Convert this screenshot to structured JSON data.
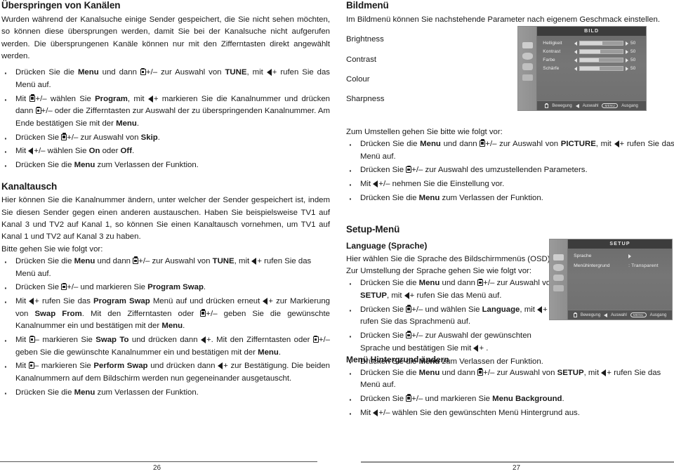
{
  "left_page": {
    "number": "26",
    "heading": "Überspringen von Kanälen",
    "intro": "Wurden während der Kanalsuche einige Sender gespeichert, die Sie nicht sehen möchten, so können diese übersprungen werden, damit Sie bei der Kanalsuche nicht aufgerufen werden. Die übersprungenen Kanäle können nur mit den Zifferntasten direkt angewählt werden.",
    "bullets": [
      "Drücken Sie die Menu und dann [CH]+/– zur Auswahl von TUNE, mit [VOL]+ rufen Sie das Menü auf.",
      "Mit [CH]+/– wählen Sie Program, mit [VOL]+ markieren Sie die Kanalnummer und drücken dann [CH]+/– oder die Zifferntasten zur Auswahl der zu überspringenden Kanalnummer. Am Ende bestätigen Sie mit der Menu.",
      "Drücken Sie [CH]+/– zur Auswahl von Skip.",
      "Mit [VOL]+/– wählen Sie On oder Off.",
      "Drücken Sie die Menu zum Verlassen der Funktion."
    ],
    "section2_heading": "Kanaltausch",
    "section2_intro": "Hier können Sie die Kanalnummer ändern, unter welcher der Sender gespeichert ist, indem Sie diesen Sender gegen einen anderen austauschen. Haben Sie beispielsweise TV1 auf Kanal 3 und TV2 auf Kanal 1, so können Sie einen Kanaltausch vornehmen, um TV1 auf Kanal 1 und TV2 auf Kanal 3 zu haben.",
    "section2_lead": "Bitte gehen Sie wie folgt vor:",
    "section2_bullets": [
      "Drücken Sie die Menu und dann [CH]+/– zur Auswahl von TUNE, mit [VOL]+ rufen Sie das Menü auf.",
      "Drücken Sie [CH]+/– und markieren Sie Program Swap.",
      "Mit [VOL]+ rufen Sie das Program Swap Menü auf und drücken erneut [VOL]+ zur Markierung von Swap From. Mit den Zifferntasten oder [CH]+/– geben Sie die gewünschte Kanalnummer ein und bestätigen mit der Menu.",
      "Mit [CH]– markieren Sie Swap To und drücken dann [VOL]+. Mit den Zifferntasten oder [CH]+/– geben Sie die gewünschte Kanalnummer ein und bestätigen mit der Menu.",
      "Mit [CH]– markieren Sie Perform Swap und drücken dann [VOL]+ zur Bestätigung. Die beiden Kanalnummern auf dem Bildschirm werden nun gegeneinander ausgetauscht.",
      "Drücken Sie die Menu zum Verlassen der Funktion."
    ]
  },
  "right_page": {
    "number": "27",
    "heading": "Bildmenü",
    "intro": "Im Bildmenü können Sie nachstehende Parameter nach eigenem Geschmack einstellen.",
    "params": [
      "Brightness",
      "Contrast",
      "Colour",
      "Sharpness"
    ],
    "change_lead": "Zum Umstellen gehen Sie bitte wie folgt vor:",
    "change_bullets": [
      "Drücken Sie die Menu und dann [CH]+/– zur Auswahl von PICTURE, mit [VOL]+ rufen Sie das Menü auf.",
      "Drücken Sie [CH]+/– zur Auswahl des umzustellenden Parameters.",
      "Mit [VOL]+/– nehmen Sie die Einstellung vor.",
      "Drücken Sie die Menu zum Verlassen der Funktion."
    ],
    "setup_heading": "Setup-Menü",
    "language_heading": "Language (Sprache)",
    "language_line1": "Hier wählen Sie die Sprache des Bildschirmmenüs (OSD).",
    "language_line2": "Zur Umstellung der Sprache gehen Sie wie folgt vor:",
    "language_bullets": [
      "Drücken Sie die Menu und dann [CH]+/– zur Auswahl von SETUP, mit [VOL]+ rufen Sie das Menü auf.",
      "Drücken Sie [CH]+/– und wählen Sie Language, mit [VOL]+ rufen Sie das Sprachmenü auf.",
      "Drücken Sie [CH]+/– zur Auswahl der gewünschten Sprache und bestätigen Sie mit [VOL]+ .",
      "Drücken Sie die Menu zum Verlassen der Funktion."
    ],
    "bg_heading": "Menü Hintergrund ändern",
    "bg_bullets": [
      "Drücken Sie die Menu und dann [CH]+/– zur Auswahl von SETUP, mit [VOL]+ rufen Sie das Menü auf.",
      "Drücken Sie [CH]+/– und markieren Sie Menu Background.",
      "Mit [VOL]+/– wählen Sie den gewünschten Menü Hintergrund aus."
    ]
  },
  "osd_picture": {
    "title": "BILD",
    "rows": [
      {
        "label": "Helligkeit",
        "value": "50",
        "fill": 52
      },
      {
        "label": "Kontrast",
        "value": "50",
        "fill": 48
      },
      {
        "label": "Farbe",
        "value": "50",
        "fill": 44
      },
      {
        "label": "Schärfe",
        "value": "50",
        "fill": 46
      }
    ],
    "footer": {
      "move": "Bewegung",
      "select": "Auswahl",
      "menu": "MENU",
      "exit": "Ausgang"
    }
  },
  "osd_setup": {
    "title": "SETUP",
    "rows": [
      {
        "label": "Sprache",
        "value": ""
      },
      {
        "label": "Menühintergrund",
        "value": ": Transparent"
      }
    ],
    "footer": {
      "move": "Bewegung",
      "select": "Auswahl",
      "menu": "MENU",
      "exit": "Ausgang"
    }
  },
  "colors": {
    "text": "#1a1a1a",
    "osd_bg": "#6e6e6e",
    "osd_title_bg": "#3c3c3c",
    "rule": "#555555"
  }
}
